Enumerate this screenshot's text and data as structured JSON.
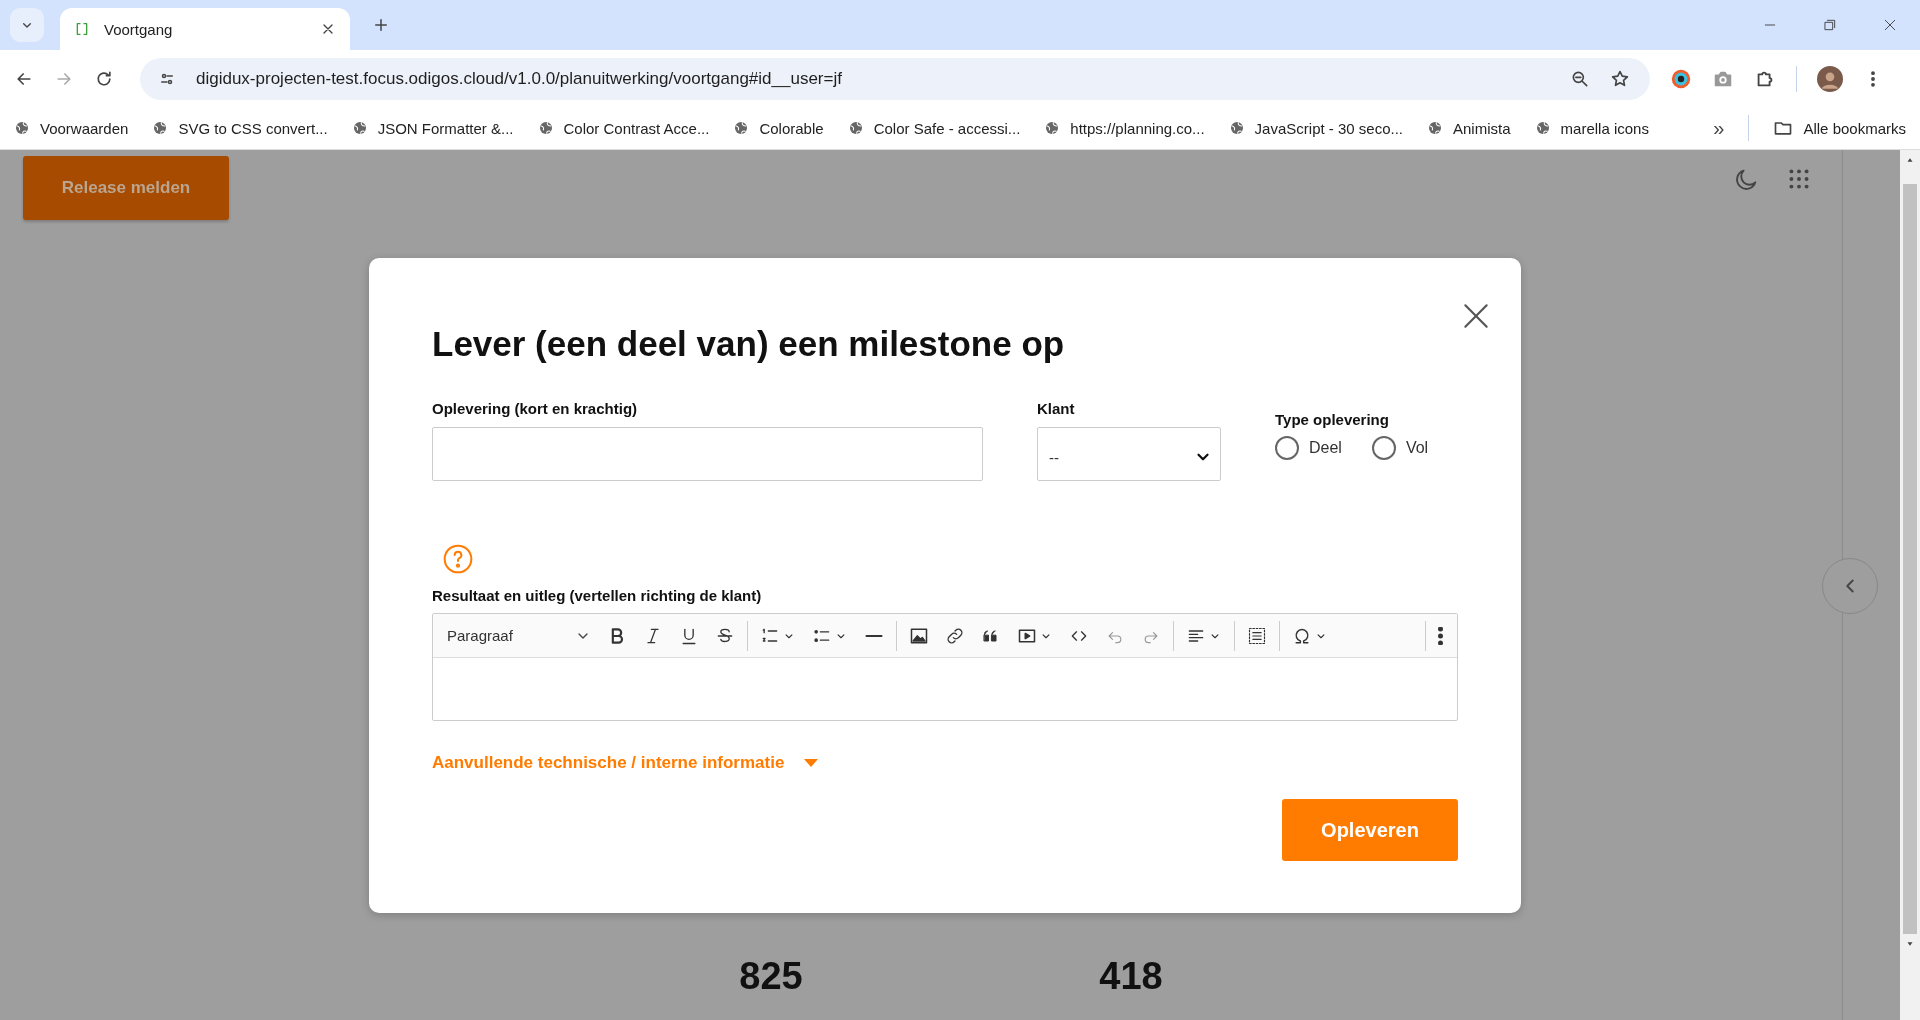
{
  "browser": {
    "tabs": [
      {
        "title": "Voortgang",
        "selected": true
      }
    ],
    "url": "digidux-projecten-test.focus.odigos.cloud/v1.0.0/planuitwerking/voortgang#id__user=jf",
    "bookmarks": [
      {
        "label": "Voorwaarden"
      },
      {
        "label": "SVG to CSS convert..."
      },
      {
        "label": "JSON Formatter &..."
      },
      {
        "label": "Color Contrast Acce..."
      },
      {
        "label": "Colorable"
      },
      {
        "label": "Color Safe - accessi..."
      },
      {
        "label": "https://planning.co..."
      },
      {
        "label": "JavaScript - 30 seco..."
      },
      {
        "label": "Animista"
      },
      {
        "label": "marella icons"
      }
    ],
    "more_bookmarks": "»",
    "all_bookmarks": "Alle bookmarks"
  },
  "page": {
    "release_button": "Release melden",
    "stats": [
      {
        "value": "825"
      },
      {
        "value": "418"
      }
    ]
  },
  "modal": {
    "title": "Lever (een deel van) een milestone op",
    "delivery_field": {
      "label": "Oplevering (kort en krachtig)"
    },
    "client_field": {
      "label": "Klant",
      "value": "--"
    },
    "type_group": {
      "label": "Type oplevering",
      "options": [
        {
          "label": "Deel",
          "selected": false
        },
        {
          "label": "Vol",
          "selected": false
        }
      ]
    },
    "editor": {
      "label": "Resultaat en uitleg (vertellen richting de klant)",
      "format": "Paragraaf"
    },
    "details_toggle": {
      "label": "Aanvullende technische / interne informatie",
      "expanded": false
    },
    "submit": "Opleveren"
  }
}
